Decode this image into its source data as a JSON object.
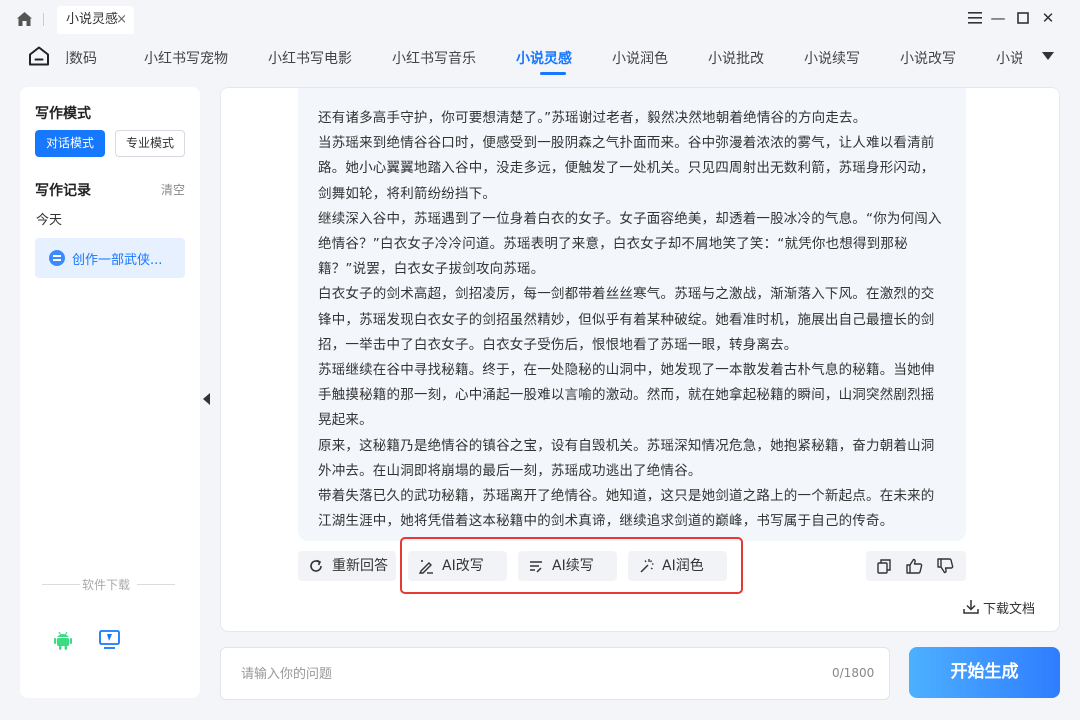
{
  "titlebar": {
    "tab_label": "小说灵感",
    "tab_close": "×",
    "min_glyph": "—",
    "close_glyph": "✕"
  },
  "nav": {
    "items": [
      "剧数码",
      "小红书写宠物",
      "小红书写电影",
      "小红书写音乐",
      "小说灵感",
      "小说润色",
      "小说批改",
      "小说续写",
      "小说改写",
      "小说"
    ],
    "active_label": "小说灵感"
  },
  "sidebar": {
    "mode_title": "写作模式",
    "mode_chat": "对话模式",
    "mode_pro": "专业模式",
    "records_title": "写作记录",
    "clear": "清空",
    "today": "今天",
    "record_item": "创作一部武侠...",
    "download_label": "软件下载"
  },
  "story": {
    "paragraphs": [
      "还有诸多高手守护，你可要想清楚了。”苏瑶谢过老者，毅然决然地朝着绝情谷的方向走去。",
      "当苏瑶来到绝情谷谷口时，便感受到一股阴森之气扑面而来。谷中弥漫着浓浓的雾气，让人难以看清前路。她小心翼翼地踏入谷中，没走多远，便触发了一处机关。只见四周射出无数利箭，苏瑶身形闪动，剑舞如轮，将利箭纷纷挡下。",
      "继续深入谷中，苏瑶遇到了一位身着白衣的女子。女子面容绝美，却透着一股冰冷的气息。“你为何闯入绝情谷？”白衣女子冷冷问道。苏瑶表明了来意，白衣女子却不屑地笑了笑：“就凭你也想得到那秘籍？”说罢，白衣女子拔剑攻向苏瑶。",
      "白衣女子的剑术高超，剑招凌厉，每一剑都带着丝丝寒气。苏瑶与之激战，渐渐落入下风。在激烈的交锋中，苏瑶发现白衣女子的剑招虽然精妙，但似乎有着某种破绽。她看准时机，施展出自己最擅长的剑招，一举击中了白衣女子。白衣女子受伤后，恨恨地看了苏瑶一眼，转身离去。",
      "苏瑶继续在谷中寻找秘籍。终于，在一处隐秘的山洞中，她发现了一本散发着古朴气息的秘籍。当她伸手触摸秘籍的那一刻，心中涌起一股难以言喻的激动。然而，就在她拿起秘籍的瞬间，山洞突然剧烈摇晃起来。",
      "原来，这秘籍乃是绝情谷的镇谷之宝，设有自毁机关。苏瑶深知情况危急，她抱紧秘籍，奋力朝着山洞外冲去。在山洞即将崩塌的最后一刻，苏瑶成功逃出了绝情谷。",
      "带着失落已久的武功秘籍，苏瑶离开了绝情谷。她知道，这只是她剑道之路上的一个新起点。在未来的江湖生涯中，她将凭借着这本秘籍中的剑术真谛，继续追求剑道的巅峰，书写属于自己的传奇。"
    ]
  },
  "actions": {
    "regenerate": "重新回答",
    "ai_rewrite": "AI改写",
    "ai_continue": "AI续写",
    "ai_polish": "AI润色",
    "download": "下载文档"
  },
  "input": {
    "placeholder": "请输入你的问题",
    "counter": "0/1800",
    "submit": "开始生成"
  }
}
